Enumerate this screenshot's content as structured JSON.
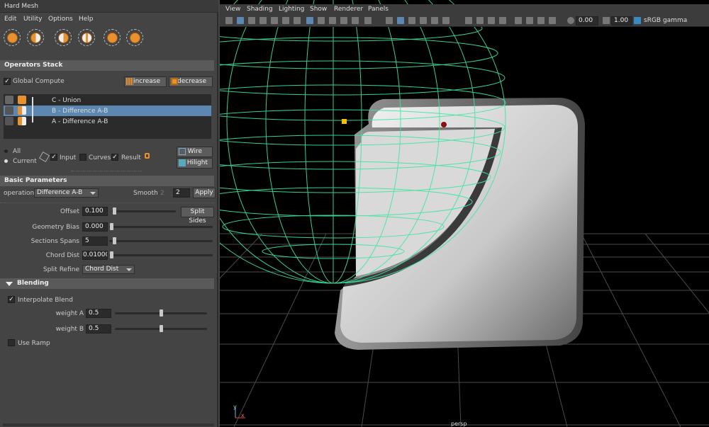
{
  "window": {
    "title": "Hard Mesh"
  },
  "menu": [
    "Edit",
    "Utility",
    "Options",
    "Help"
  ],
  "operators_stack": {
    "header": "Operators Stack",
    "global_compute": {
      "label": "Global Compute",
      "checked": true
    },
    "increase_label": "increase",
    "decrease_label": "decrease",
    "items": [
      {
        "label": "C - Union",
        "selected": false
      },
      {
        "label": "B - Difference A-B",
        "selected": true
      },
      {
        "label": "A - Difference A-B",
        "selected": false
      }
    ]
  },
  "display": {
    "all_label": "All",
    "current_label": "Current",
    "input_label": "Input",
    "curves_label": "Curves",
    "result_label": "Result",
    "wire_label": "Wire",
    "hilight_label": "Hilight"
  },
  "basic": {
    "header": "Basic Parameters",
    "operation_label": "operation",
    "operation_value": "Difference A-B",
    "smooth_label": "Smooth",
    "smooth_hint": "2",
    "smooth_value": "2",
    "apply_label": "Apply",
    "offset_label": "Offset",
    "offset_value": "0.100",
    "split_sides_label": "Split Sides",
    "geometry_bias_label": "Geometry Bias",
    "geometry_bias_value": "0.000",
    "sections_spans_label": "Sections Spans",
    "sections_spans_value": "5",
    "chord_dist_label": "Chord Dist",
    "chord_dist_value": "0.010000",
    "split_refine_label": "Split Refine",
    "split_refine_value": "Chord Dist"
  },
  "blending": {
    "header": "Blending",
    "interpolate_label": "Interpolate Blend",
    "weight_a_label": "weight A",
    "weight_a_value": "0.5",
    "weight_b_label": "weight B",
    "weight_b_value": "0.5",
    "use_ramp_label": "Use Ramp"
  },
  "viewport": {
    "menu": [
      "View",
      "Shading",
      "Lighting",
      "Show",
      "Renderer",
      "Panels"
    ],
    "exposure": "0.00",
    "gamma": "1.00",
    "colorspace": "sRGB gamma",
    "camera": "persp",
    "axis_y": "y",
    "axis_x": "x"
  },
  "colors": {
    "wire": "#3ee6a0",
    "selection": "#5b87b0",
    "accent": "#e7922f"
  }
}
